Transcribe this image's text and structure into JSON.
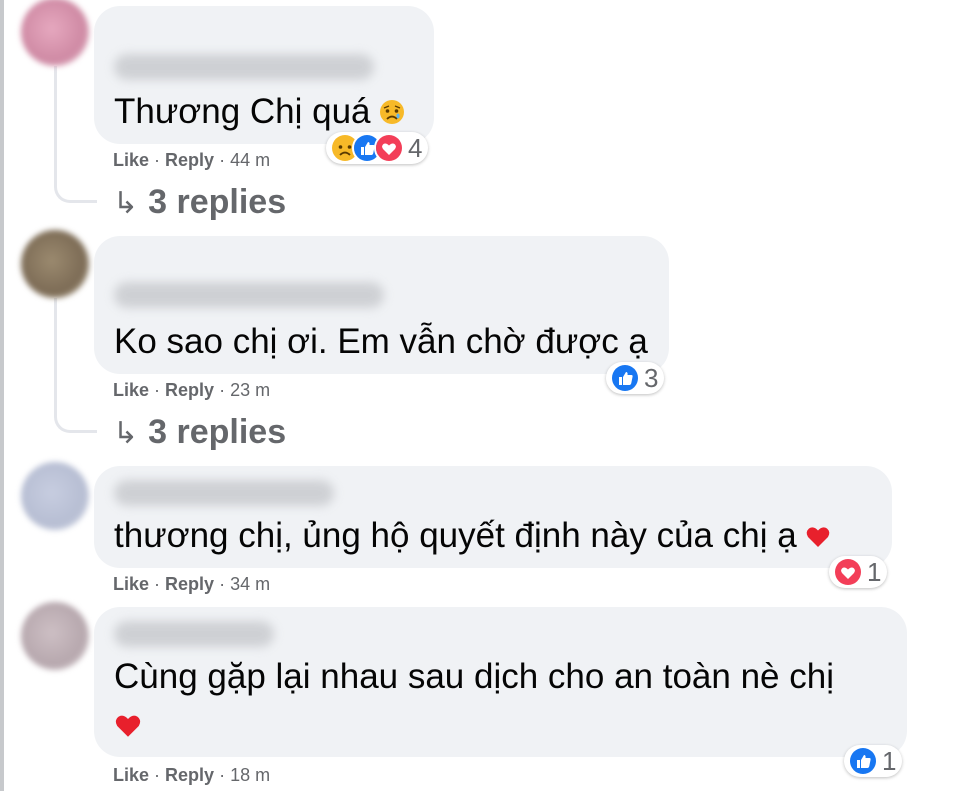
{
  "comments": [
    {
      "text": "Thương Chị quá",
      "like": "Like",
      "reply": "Reply",
      "time": "44 m",
      "reaction_count": "4",
      "replies": "3 replies",
      "reactions": [
        "sad",
        "like",
        "love"
      ]
    },
    {
      "text": "Ko sao chị ơi. Em vẫn chờ được ạ",
      "like": "Like",
      "reply": "Reply",
      "time": "23 m",
      "reaction_count": "3",
      "replies": "3 replies",
      "reactions": [
        "like"
      ]
    },
    {
      "text": "thương chị, ủng hộ quyết định này của chị ạ",
      "like": "Like",
      "reply": "Reply",
      "time": "34 m",
      "reaction_count": "1",
      "reactions": [
        "love"
      ]
    },
    {
      "text_line1": "Cùng gặp lại nhau sau dịch cho an toàn nè chị",
      "like": "Like",
      "reply": "Reply",
      "time": "18 m",
      "reaction_count": "1",
      "reactions": [
        "like"
      ]
    }
  ],
  "colors": {
    "bubble": "#f0f2f5",
    "meta": "#65676b",
    "like_blue": "#1877f2",
    "love_red": "#f33e58",
    "sad_yellow": "#f7b928"
  },
  "separator": " · "
}
